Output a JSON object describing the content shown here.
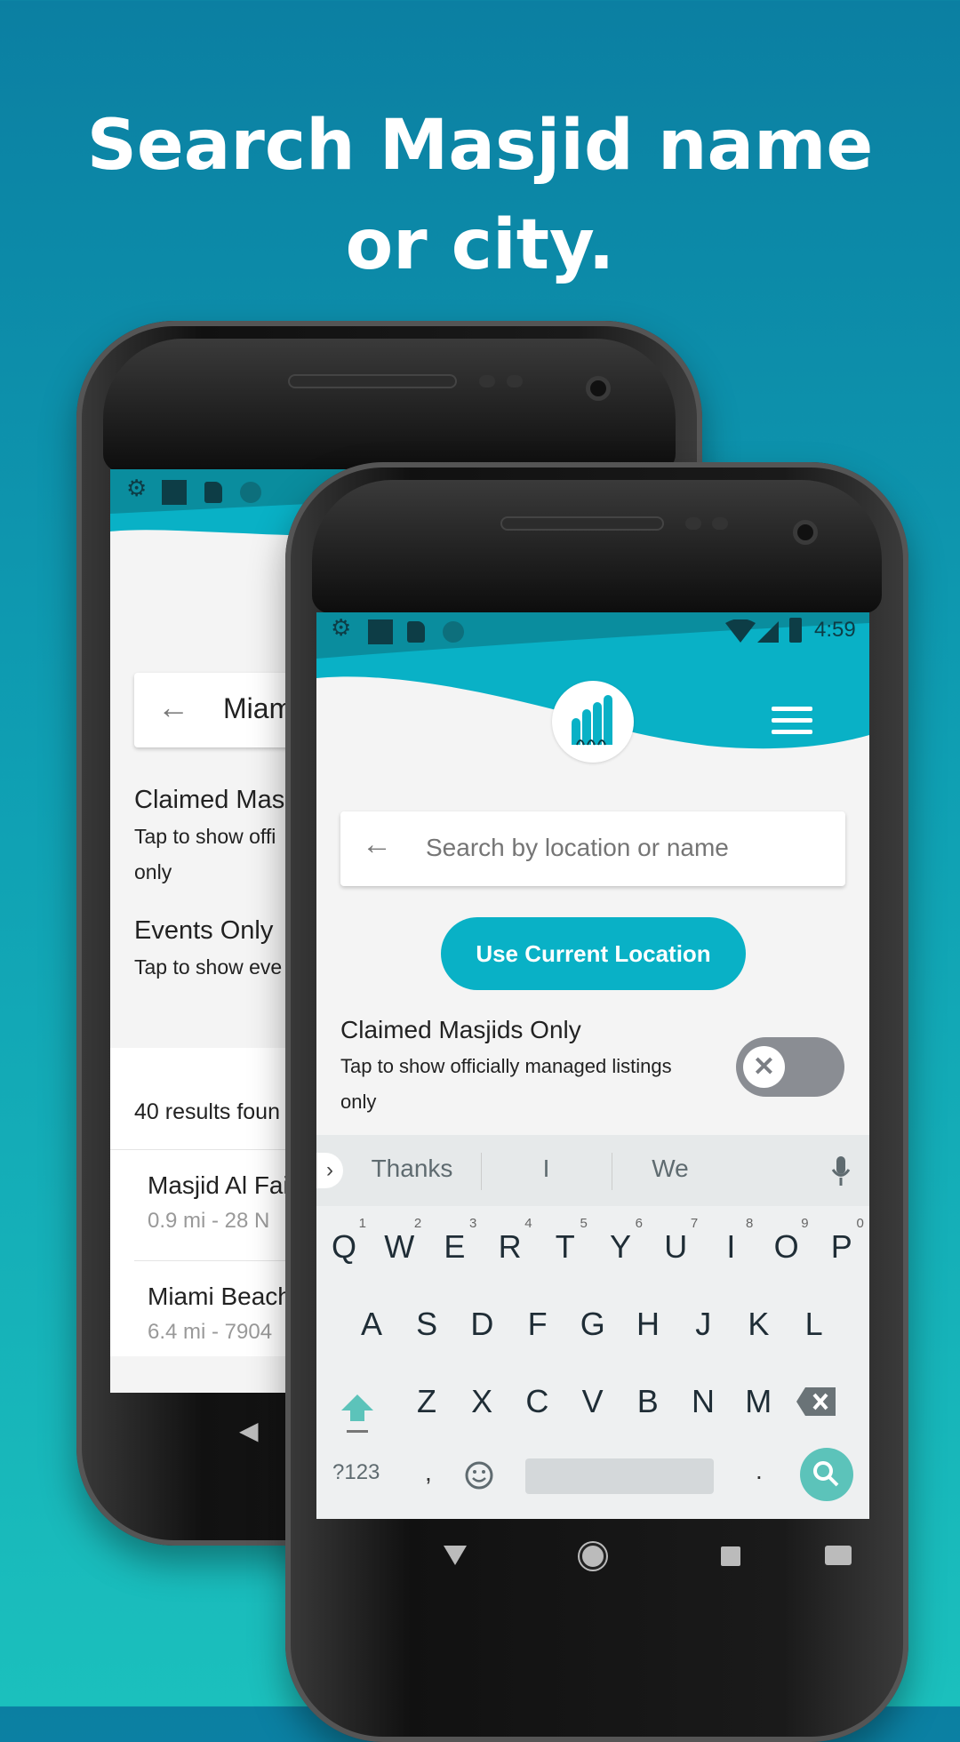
{
  "headline": {
    "line1": "Search Masjid name",
    "line2": "or city."
  },
  "colors": {
    "teal": "#09b1c6",
    "status_dark": "#0a8d9e",
    "keyboard_bg": "#eef0f1",
    "search_key": "#5cc3ba",
    "toggle_off": "#8a8d93"
  },
  "back_phone": {
    "search_value": "Miam",
    "claimed_title": "Claimed Mas",
    "claimed_desc": "Tap to show offi",
    "claimed_desc2": "only",
    "events_title": "Events Only",
    "events_desc": "Tap to show eve",
    "results_count": "40 results foun",
    "results": [
      {
        "name": "Masjid Al Fai",
        "detail": "0.9 mi - 28  N"
      },
      {
        "name": "Miami Beach",
        "detail": "6.4 mi - 7904"
      }
    ]
  },
  "front_phone": {
    "status": {
      "time": "4:59"
    },
    "search": {
      "placeholder": "Search by location or name"
    },
    "use_location_label": "Use Current Location",
    "claimed": {
      "title": "Claimed Masjids Only",
      "desc": "Tap to show officially managed listings",
      "desc2": "only",
      "enabled": false
    },
    "keyboard": {
      "suggestions": [
        "Thanks",
        "I",
        "We"
      ],
      "row1": [
        "Q",
        "W",
        "E",
        "R",
        "T",
        "Y",
        "U",
        "I",
        "O",
        "P"
      ],
      "row1_nums": [
        "1",
        "2",
        "3",
        "4",
        "5",
        "6",
        "7",
        "8",
        "9",
        "0"
      ],
      "row2": [
        "A",
        "S",
        "D",
        "F",
        "G",
        "H",
        "J",
        "K",
        "L"
      ],
      "row3": [
        "Z",
        "X",
        "C",
        "V",
        "B",
        "N",
        "M"
      ],
      "symbols_label": "?123",
      "comma": ",",
      "period": "."
    }
  }
}
